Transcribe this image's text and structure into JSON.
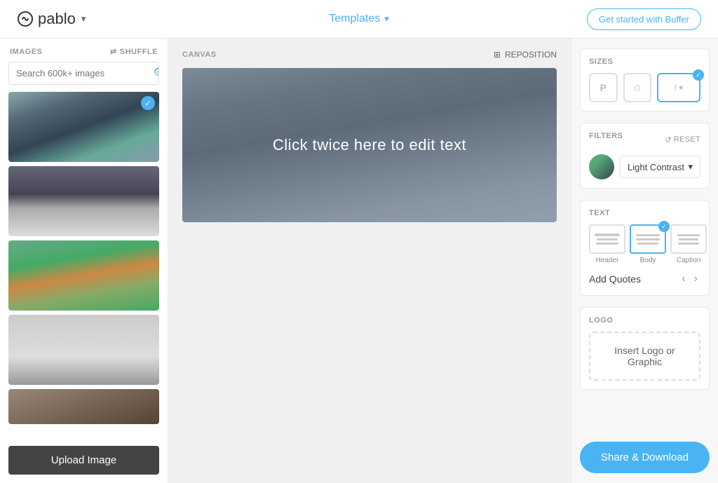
{
  "header": {
    "logo_text": "pablo",
    "templates_label": "Templates",
    "cta_label": "Get started with Buffer"
  },
  "sidebar": {
    "title": "IMAGES",
    "shuffle_label": "SHUFFLE",
    "search_placeholder": "Search 600k+ images",
    "upload_button": "Upload Image",
    "images": [
      {
        "id": "img1",
        "style": "img-city",
        "selected": true
      },
      {
        "id": "img2",
        "style": "img-coast",
        "selected": false
      },
      {
        "id": "img3",
        "style": "img-village",
        "selected": false
      },
      {
        "id": "img4",
        "style": "img-beach",
        "selected": false
      },
      {
        "id": "img5",
        "style": "img-partial",
        "selected": false
      }
    ]
  },
  "canvas": {
    "label": "CANVAS",
    "reposition_label": "REPOSITION",
    "canvas_text": "Click twice here to edit text"
  },
  "right_panel": {
    "sizes": {
      "title": "SIZES",
      "buttons": [
        {
          "id": "pinterest",
          "icon": "P",
          "active": false
        },
        {
          "id": "circle",
          "icon": "○",
          "active": false
        },
        {
          "id": "twitter",
          "icon": "t+b",
          "active": true
        }
      ]
    },
    "filters": {
      "title": "FILTERS",
      "reset_label": "RESET",
      "current_filter": "Light Contrast"
    },
    "text": {
      "title": "TEXT",
      "styles": [
        {
          "id": "header",
          "label": "Header",
          "active": false
        },
        {
          "id": "body",
          "label": "Body",
          "active": true
        },
        {
          "id": "caption",
          "label": "Caption",
          "active": false
        }
      ],
      "add_quotes_label": "Add Quotes"
    },
    "logo": {
      "title": "LOGO",
      "insert_label": "Insert Logo or Graphic"
    },
    "share": {
      "label": "Share & Download"
    }
  }
}
